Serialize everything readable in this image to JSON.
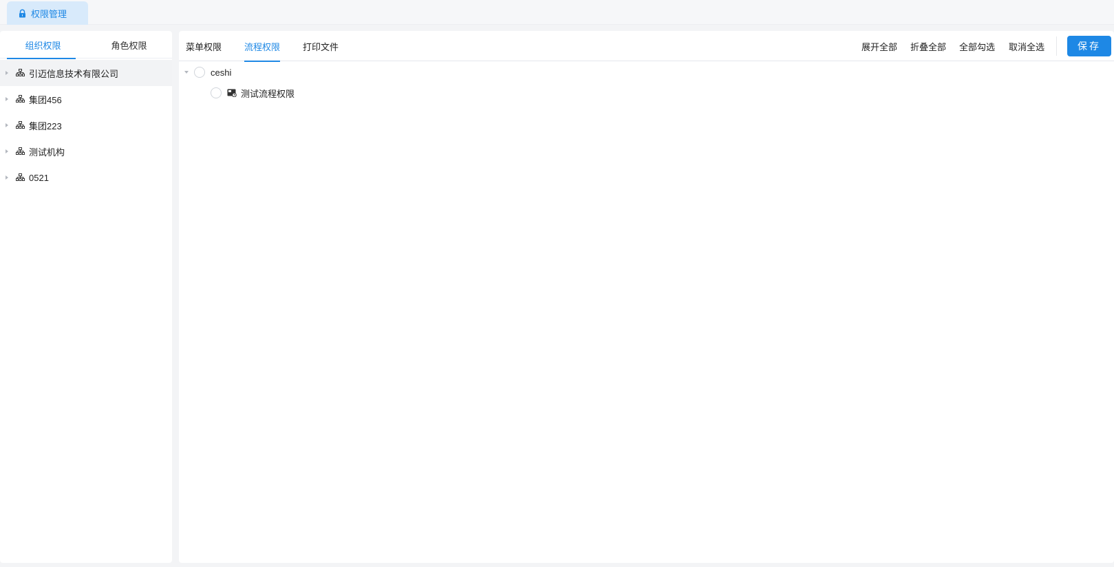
{
  "top_tab": {
    "label": "权限管理",
    "icon": "lock-icon"
  },
  "left_panel": {
    "tabs": [
      {
        "label": "组织权限",
        "active": true
      },
      {
        "label": "角色权限",
        "active": false
      }
    ],
    "org_tree": [
      {
        "label": "引迈信息技术有限公司",
        "icon": "org-icon",
        "selected": true
      },
      {
        "label": "集团456",
        "icon": "org-icon"
      },
      {
        "label": "集团223",
        "icon": "org-icon"
      },
      {
        "label": "测试机构",
        "icon": "org-icon"
      },
      {
        "label": "0521",
        "icon": "org-icon"
      }
    ]
  },
  "right_panel": {
    "tabs": [
      {
        "label": "菜单权限",
        "active": false
      },
      {
        "label": "流程权限",
        "active": true
      },
      {
        "label": "打印文件",
        "active": false
      }
    ],
    "actions": {
      "expand_all": "展开全部",
      "collapse_all": "折叠全部",
      "select_all": "全部勾选",
      "deselect_all": "取消全选",
      "save": "保存"
    },
    "perm_tree": {
      "root": {
        "label": "ceshi",
        "expanded": true,
        "checked": false
      },
      "children": [
        {
          "label": "测试流程权限",
          "icon": "flow-icon",
          "checked": false
        }
      ]
    }
  },
  "colors": {
    "accent": "#1e88e5",
    "background": "#f3f4f6",
    "selected_row": "#f2f3f5"
  }
}
